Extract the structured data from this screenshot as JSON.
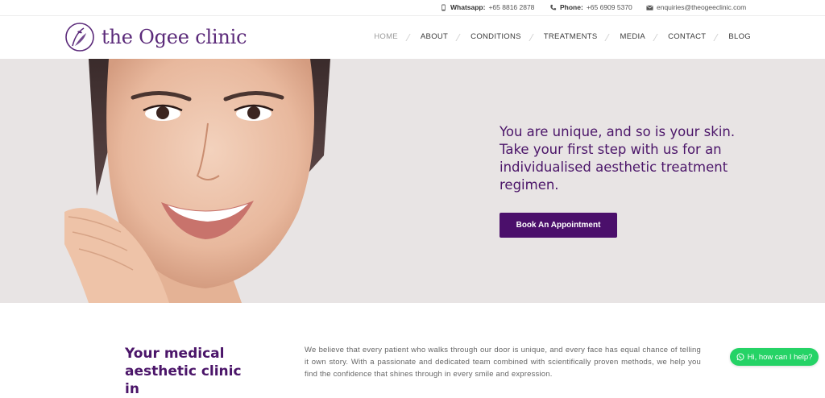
{
  "topbar": {
    "whatsapp_label": "Whatsapp:",
    "whatsapp_value": "+65 8816 2878",
    "phone_label": "Phone:",
    "phone_value": "+65 6909 5370",
    "email": "enquiries@theogeeclinic.com"
  },
  "header": {
    "logo_text": "the Ogee clinic",
    "nav": [
      "HOME",
      "ABOUT",
      "CONDITIONS",
      "TREATMENTS",
      "MEDIA",
      "CONTACT",
      "BLOG"
    ],
    "active_item": "HOME"
  },
  "hero": {
    "tagline": "You are unique, and so is your skin. Take your first step with us for an individualised aesthetic treatment regimen.",
    "cta_label": "Book An Appointment"
  },
  "about": {
    "heading": "Your medical aesthetic clinic in",
    "body": "We believe that every patient who walks through our door is unique, and every face has equal chance of telling it own story. With a passionate and dedicated team combined with scientifically proven methods, we help you find the confidence that shines through in every smile and expression."
  },
  "chat": {
    "label": "Hi, how can I help?"
  },
  "colors": {
    "brand_purple": "#4b0f6b",
    "hero_background": "#e8e4e4",
    "chat_green": "#25d366"
  },
  "icons": {
    "whatsapp": "mobile-phone-icon",
    "phone": "phone-handset-icon",
    "email": "envelope-icon",
    "logo": "ogee-leaf-logo-icon",
    "chat": "whatsapp-icon"
  }
}
